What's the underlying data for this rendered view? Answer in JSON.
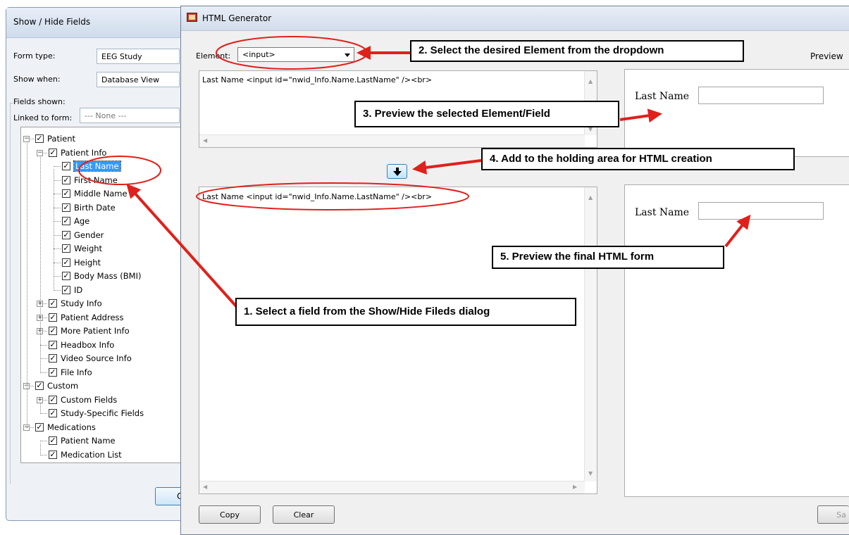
{
  "show_hide": {
    "title": "Show / Hide Fields",
    "form_type_label": "Form type:",
    "form_type_value": "EEG Study",
    "show_when_label": "Show when:",
    "show_when_value": "Database View",
    "fields_shown_label": "Fields shown:",
    "linked_label": "Linked to form:",
    "linked_value": "--- None ---",
    "ok_label": "OK",
    "tree": [
      {
        "label": "Patient",
        "level": 0,
        "expander": "minus",
        "checked": true
      },
      {
        "label": "Patient Info",
        "level": 1,
        "expander": "minus",
        "checked": true
      },
      {
        "label": "Last Name",
        "level": 2,
        "expander": "",
        "checked": true,
        "selected": true
      },
      {
        "label": "First Name",
        "level": 2,
        "expander": "",
        "checked": true
      },
      {
        "label": "Middle Name",
        "level": 2,
        "expander": "",
        "checked": true
      },
      {
        "label": "Birth Date",
        "level": 2,
        "expander": "",
        "checked": true
      },
      {
        "label": "Age",
        "level": 2,
        "expander": "",
        "checked": true
      },
      {
        "label": "Gender",
        "level": 2,
        "expander": "",
        "checked": true
      },
      {
        "label": "Weight",
        "level": 2,
        "expander": "",
        "checked": true
      },
      {
        "label": "Height",
        "level": 2,
        "expander": "",
        "checked": true
      },
      {
        "label": "Body Mass (BMI)",
        "level": 2,
        "expander": "",
        "checked": true
      },
      {
        "label": "ID",
        "level": 2,
        "expander": "",
        "checked": true
      },
      {
        "label": "Study Info",
        "level": 1,
        "expander": "plus",
        "checked": true
      },
      {
        "label": "Patient Address",
        "level": 1,
        "expander": "plus",
        "checked": true
      },
      {
        "label": "More Patient Info",
        "level": 1,
        "expander": "plus",
        "checked": true
      },
      {
        "label": "Headbox Info",
        "level": 1,
        "expander": "",
        "checked": true
      },
      {
        "label": "Video Source Info",
        "level": 1,
        "expander": "",
        "checked": true
      },
      {
        "label": "File Info",
        "level": 1,
        "expander": "",
        "checked": true
      },
      {
        "label": "Custom",
        "level": 0,
        "expander": "minus",
        "checked": true
      },
      {
        "label": "Custom Fields",
        "level": 1,
        "expander": "plus",
        "checked": true
      },
      {
        "label": "Study-Specific Fields",
        "level": 1,
        "expander": "",
        "checked": true
      },
      {
        "label": "Medications",
        "level": 0,
        "expander": "minus",
        "checked": true
      },
      {
        "label": "Patient Name",
        "level": 1,
        "expander": "",
        "checked": true
      },
      {
        "label": "Medication List",
        "level": 1,
        "expander": "",
        "checked": true
      }
    ]
  },
  "generator": {
    "title": "HTML Generator",
    "element_label": "Element:",
    "element_value": "<input>",
    "preview_label": "Preview",
    "element_code": "Last Name <input id=\"nwid_Info.Name.LastName\" /><br>",
    "holding_code": "Last Name <input id=\"nwid_Info.Name.LastName\" /><br>",
    "preview_field_label": "Last Name",
    "final_field_label": "Last Name",
    "copy_label": "Copy",
    "clear_label": "Clear",
    "save_label": "Sa"
  },
  "annotations": {
    "step1": "1.  Select a field from the Show/Hide Fileds dialog",
    "step2": "2.  Select the desired Element from the dropdown",
    "step3": "3.  Preview the selected Element/Field",
    "step4": "4.  Add to the holding area for HTML creation",
    "step5": "5.  Preview the final HTML form"
  },
  "colors": {
    "annotation_red": "#e0201b",
    "selection_blue": "#3399ff"
  }
}
